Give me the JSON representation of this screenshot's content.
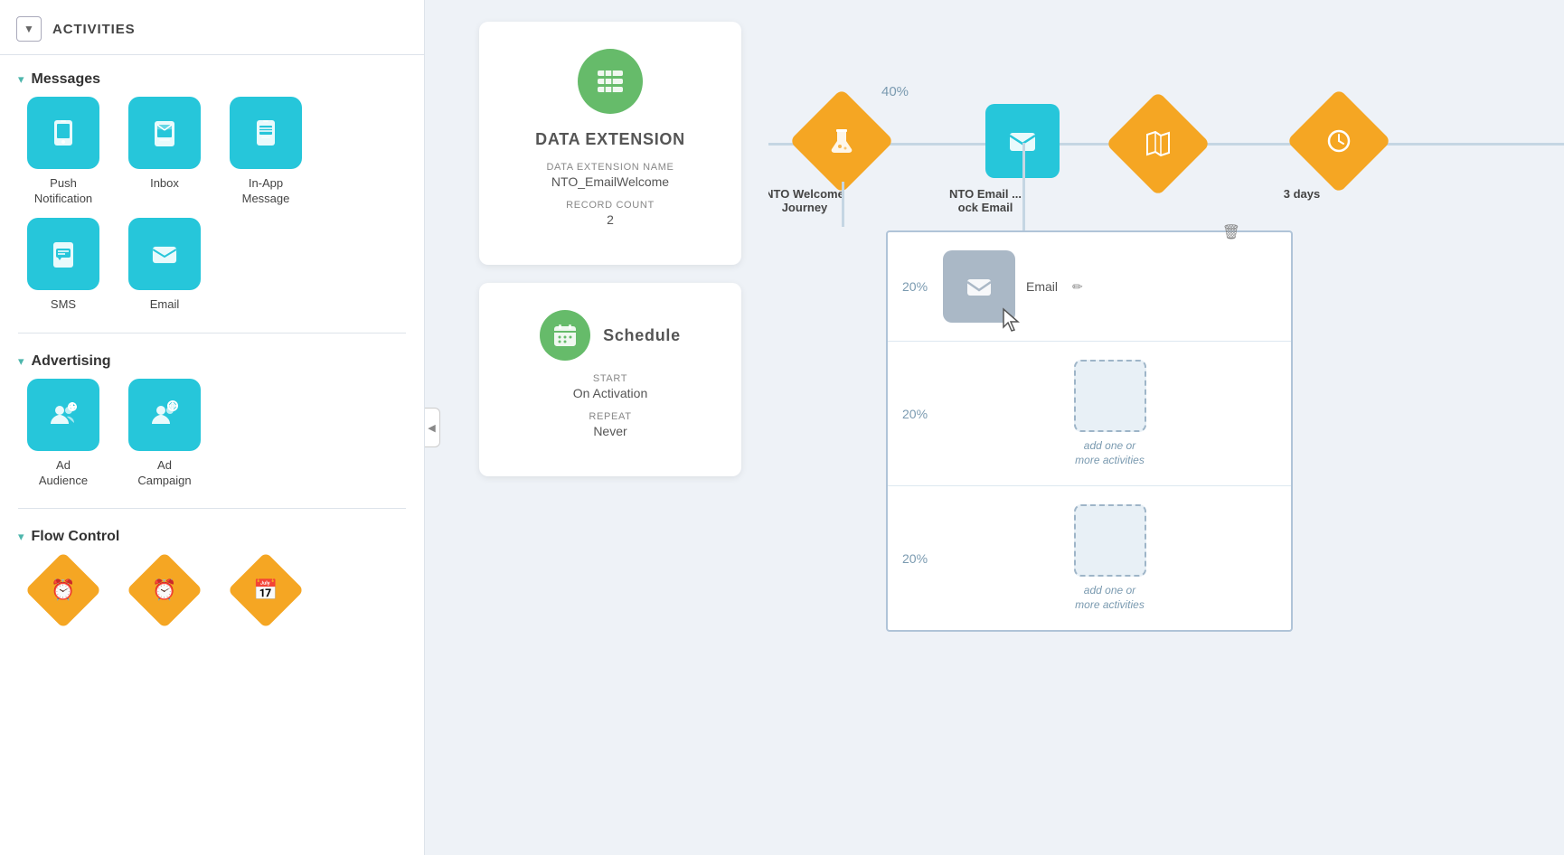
{
  "sidebar": {
    "activities_label": "ACTIVITIES",
    "collapse_icon": "▼",
    "sections": [
      {
        "id": "messages",
        "label": "Messages",
        "chevron": "▾",
        "items": [
          {
            "id": "push-notification",
            "label": "Push\nNotification",
            "icon": "📱",
            "color": "teal"
          },
          {
            "id": "inbox",
            "label": "Inbox",
            "icon": "📱",
            "color": "teal"
          },
          {
            "id": "in-app-message",
            "label": "In-App\nMessage",
            "icon": "📱",
            "color": "teal"
          },
          {
            "id": "sms",
            "label": "SMS",
            "icon": "💬",
            "color": "teal"
          },
          {
            "id": "email",
            "label": "Email",
            "icon": "✉",
            "color": "teal"
          }
        ]
      },
      {
        "id": "advertising",
        "label": "Advertising",
        "chevron": "▾",
        "items": [
          {
            "id": "ad-audience",
            "label": "Ad\nAudience",
            "icon": "👥",
            "color": "teal"
          },
          {
            "id": "ad-campaign",
            "label": "Ad\nCampaign",
            "icon": "👥",
            "color": "teal"
          }
        ]
      },
      {
        "id": "flow-control",
        "label": "Flow Control",
        "chevron": "▾",
        "items": [
          {
            "id": "flow1",
            "label": "",
            "icon": "🕐",
            "color": "orange"
          },
          {
            "id": "flow2",
            "label": "",
            "icon": "🕐",
            "color": "orange"
          },
          {
            "id": "flow3",
            "label": "",
            "icon": "📅",
            "color": "orange"
          }
        ]
      }
    ]
  },
  "canvas": {
    "data_extension_card": {
      "title": "DATA EXTENSION",
      "field1_label": "DATA EXTENSION NAME",
      "field1_value": "NTO_EmailWelcome",
      "field2_label": "RECORD COUNT",
      "field2_value": "2"
    },
    "schedule_card": {
      "title": "Schedule",
      "start_label": "START",
      "start_value": "On Activation",
      "repeat_label": "REPEAT",
      "repeat_value": "Never"
    },
    "flow": {
      "nodes": [
        {
          "id": "nto-welcome",
          "type": "diamond",
          "label": "NTO Welcome\nJourney",
          "icon": "🧪",
          "pct": "40%"
        },
        {
          "id": "nto-email",
          "type": "teal",
          "label": "NTO Email ...\nock Email",
          "icon": "✉"
        },
        {
          "id": "flow-icon",
          "type": "diamond",
          "label": "",
          "icon": "🗺"
        },
        {
          "id": "3days",
          "type": "diamond",
          "label": "3 days",
          "icon": "🕐"
        }
      ],
      "split_rows": [
        {
          "pct": "20%",
          "content_type": "email",
          "label": "Email",
          "has_delete": true,
          "has_edit": true
        },
        {
          "pct": "20%",
          "content_type": "placeholder",
          "label": "add one or\nmore activities"
        },
        {
          "pct": "20%",
          "content_type": "placeholder",
          "label": "add one or\nmore activities"
        }
      ]
    }
  },
  "icons": {
    "list": "☰",
    "calendar": "📅",
    "mail": "✉",
    "phone": "📱",
    "chat": "💬",
    "people": "👥",
    "flask": "⚗",
    "clock": "⏰",
    "map": "🗺",
    "clock2": "⏰",
    "trash": "🗑",
    "pencil": "✏"
  },
  "colors": {
    "teal": "#26c6da",
    "orange": "#f5a623",
    "green": "#66bb6a",
    "grey_node": "#aab8c6"
  }
}
